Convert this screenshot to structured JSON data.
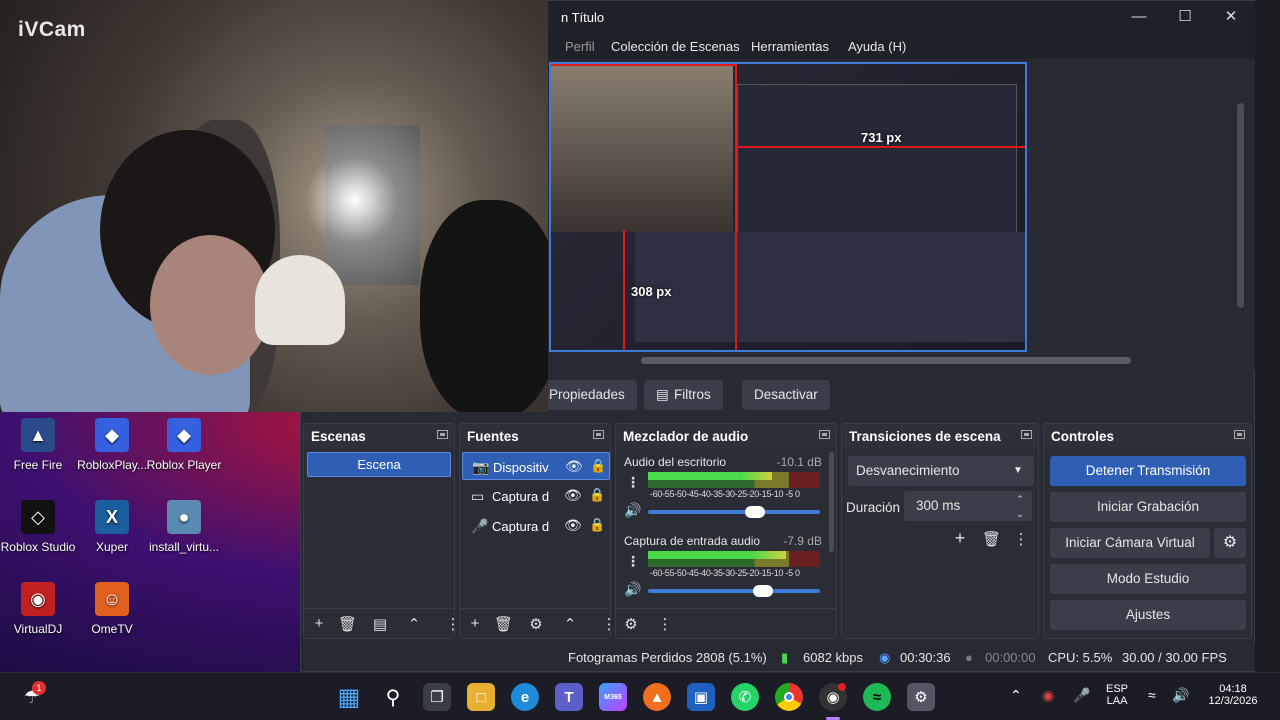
{
  "ivcam": {
    "label": "iVCam"
  },
  "desktop_icons": [
    {
      "label": "Free Fire",
      "icon": "freefire-icon",
      "color": "#2a4a8a"
    },
    {
      "label": "RobloxPlay...",
      "icon": "roblox-icon",
      "color": "#3561e0"
    },
    {
      "label": "Roblox Player",
      "icon": "roblox-icon",
      "color": "#3561e0"
    },
    {
      "label": "Roblox Studio",
      "icon": "roblox-studio-icon",
      "color": "#111111"
    },
    {
      "label": "Xuper",
      "icon": "xuper-icon",
      "color": "#1b5e9e"
    },
    {
      "label": "install_virtu...",
      "icon": "installer-icon",
      "color": "#5a8ab0"
    },
    {
      "label": "VirtualDJ",
      "icon": "virtualdj-icon",
      "color": "#c02020"
    },
    {
      "label": "OmeTV",
      "icon": "ometv-icon",
      "color": "#e06020"
    }
  ],
  "obs": {
    "title": "n Título",
    "menu": [
      "Perfil",
      "Colección de Escenas",
      "Herramientas",
      "Ayuda (H)"
    ],
    "preview": {
      "measure_h": "731 px",
      "measure_v": "308 px"
    },
    "source_toolbar": {
      "properties": "Propiedades",
      "filters": "Filtros",
      "deactivate": "Desactivar"
    },
    "scenes": {
      "title": "Escenas",
      "items": [
        "Escena"
      ]
    },
    "sources": {
      "title": "Fuentes",
      "items": [
        {
          "label": "Dispositiv",
          "icon": "camera-icon",
          "selected": true
        },
        {
          "label": "Captura d",
          "icon": "monitor-icon",
          "selected": false
        },
        {
          "label": "Captura d",
          "icon": "microphone-icon",
          "selected": false
        }
      ]
    },
    "mixer": {
      "title": "Mezclador de audio",
      "scale": "-60-55-50-45-40-35-30-25-20-15-10 -5  0",
      "channels": [
        {
          "name": "Audio del escritorio",
          "db": "-10.1 dB",
          "level": 0.72,
          "volume": 0.62
        },
        {
          "name": "Captura de entrada audio",
          "db": "-7.9 dB",
          "level": 0.8,
          "volume": 0.67
        }
      ]
    },
    "transitions": {
      "title": "Transiciones de escena",
      "selected": "Desvanecimiento",
      "duration_label": "Duración",
      "duration_value": "300 ms"
    },
    "controls": {
      "title": "Controles",
      "stop_stream": "Detener Transmisión",
      "start_record": "Iniciar Grabación",
      "start_virtualcam": "Iniciar Cámara Virtual",
      "studio_mode": "Modo Estudio",
      "settings": "Ajustes"
    },
    "status": {
      "dropped": "Fotogramas Perdidos 2808 (5.1%)",
      "bitrate": "6082 kbps",
      "stream_time": "00:30:36",
      "record_time": "00:00:00",
      "cpu": "CPU: 5.5%",
      "fps": "30.00 / 30.00 FPS"
    }
  },
  "taskbar": {
    "weather_badge": "1",
    "lang": "ESP",
    "lang2": "LAA",
    "time": "04:18",
    "date": "12/3/2026",
    "m365": "M365"
  },
  "colors": {
    "accent": "#2f5fb5",
    "bg": "#272a33",
    "record_red": "#e01818"
  }
}
